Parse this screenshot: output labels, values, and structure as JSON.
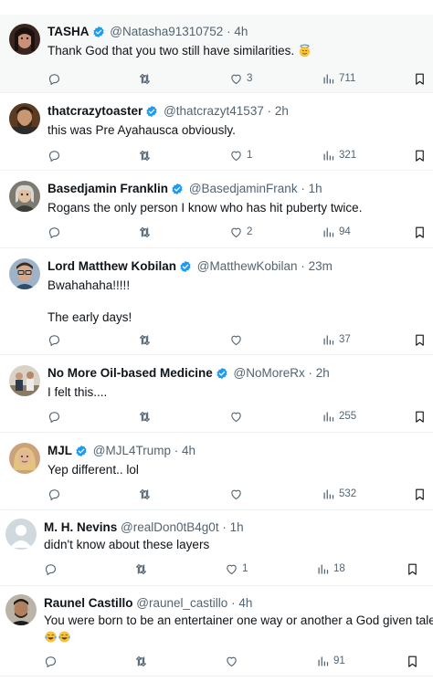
{
  "colors": {
    "verified": "#1d9bf0",
    "secondary_text": "#536471",
    "primary_text": "#0f1419",
    "divider": "#eff3f4"
  },
  "tweets": [
    {
      "name": "TASHA",
      "verified": true,
      "handle": "@Natasha91310752",
      "sep": "·",
      "time": "4h",
      "text": [
        "Thank God that you two still have similarities."
      ],
      "text_emoji": "face-with-halo-emoji",
      "reply_count": "",
      "retweet_count": "",
      "like_count": "3",
      "view_count": "711",
      "avatar": "avatar-woman-dark-hair"
    },
    {
      "name": "thatcrazytoaster",
      "verified": true,
      "handle": "@thatcrazyt41537",
      "sep": "·",
      "time": "2h",
      "text": [
        "this was Pre Ayahausca obviously."
      ],
      "reply_count": "",
      "retweet_count": "",
      "like_count": "1",
      "view_count": "321",
      "avatar": "avatar-man-beard"
    },
    {
      "name": "Basedjamin Franklin",
      "verified": true,
      "handle": "@BasedjaminFrank",
      "sep": "·",
      "time": "1h",
      "text": [
        "Rogans the only person I know who has hit puberty twice."
      ],
      "reply_count": "",
      "retweet_count": "",
      "like_count": "2",
      "view_count": "94",
      "avatar": "avatar-franklin-portrait"
    },
    {
      "name": "Lord Matthew Kobilan",
      "verified": true,
      "handle": "@MatthewKobilan",
      "sep": "·",
      "time": "23m",
      "text": [
        "Bwahahaha!!!!!",
        "The early days!"
      ],
      "reply_count": "",
      "retweet_count": "",
      "like_count": "",
      "view_count": "37",
      "avatar": "avatar-man-glasses"
    },
    {
      "name": "No More Oil-based Medicine",
      "verified": true,
      "handle": "@NoMoreRx",
      "sep": "·",
      "time": "2h",
      "text": [
        "I felt this...."
      ],
      "reply_count": "",
      "retweet_count": "",
      "like_count": "",
      "view_count": "255",
      "avatar": "avatar-group-photo"
    },
    {
      "name": "MJL",
      "verified": true,
      "handle": "@MJL4Trump",
      "sep": "·",
      "time": "4h",
      "text": [
        "Yep different.. lol"
      ],
      "reply_count": "",
      "retweet_count": "",
      "like_count": "",
      "view_count": "532",
      "avatar": "avatar-woman-blonde"
    },
    {
      "name": "M. H. Nevins",
      "verified": false,
      "handle": "@realDon0tB4g0t",
      "sep": "·",
      "time": "1h",
      "text": [
        "didn't know about these layers"
      ],
      "reply_count": "",
      "retweet_count": "",
      "like_count": "1",
      "view_count": "18",
      "avatar": "avatar-default-silhouette"
    },
    {
      "name": "Raunel Castillo",
      "verified": false,
      "handle": "@raunel_castillo",
      "sep": "·",
      "time": "4h",
      "text": [
        "You were born to be an entertainer one way or another a God given talent"
      ],
      "text_emoji_line": "tears-of-joy-emoji x2",
      "reply_count": "",
      "retweet_count": "",
      "like_count": "",
      "view_count": "91",
      "avatar": "avatar-man-dark-hair"
    }
  ]
}
